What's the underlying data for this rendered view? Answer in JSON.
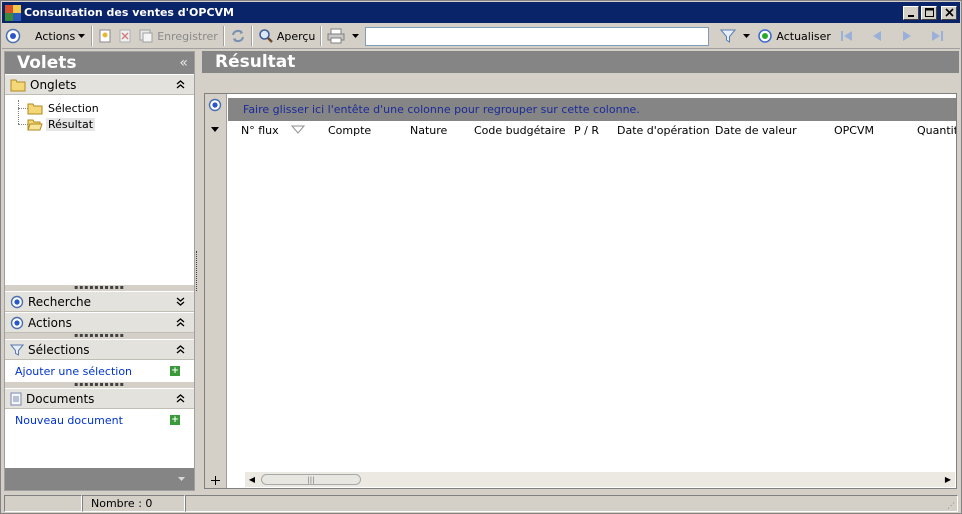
{
  "window": {
    "title": "Consultation des ventes d'OPCVM"
  },
  "toolbar": {
    "actions_label": "Actions",
    "save_label": "Enregistrer",
    "preview_label": "Aperçu",
    "search_value": "",
    "refresh_label": "Actualiser"
  },
  "left": {
    "header": "Volets",
    "collapse_glyph": "«",
    "onglets": {
      "label": "Onglets",
      "items": [
        "Sélection",
        "Résultat"
      ],
      "selected": "Résultat"
    },
    "recherche": {
      "label": "Recherche"
    },
    "actions": {
      "label": "Actions"
    },
    "selections": {
      "label": "Sélections",
      "link": "Ajouter une sélection"
    },
    "documents": {
      "label": "Documents",
      "link": "Nouveau document"
    }
  },
  "result": {
    "header": "Résultat",
    "group_hint": "Faire glisser ici l'entête d'une colonne pour regrouper sur cette colonne.",
    "columns": [
      "N° flux",
      "Compte",
      "Nature",
      "Code budgétaire",
      "P / R",
      "Date d'opération",
      "Date de valeur",
      "OPCVM",
      "Quantit"
    ]
  },
  "status": {
    "count": "Nombre : 0"
  },
  "colors": {
    "title_bar": "#0a246a",
    "panel_header": "#858585",
    "link": "#0033cc",
    "face": "#d4d0c8"
  }
}
